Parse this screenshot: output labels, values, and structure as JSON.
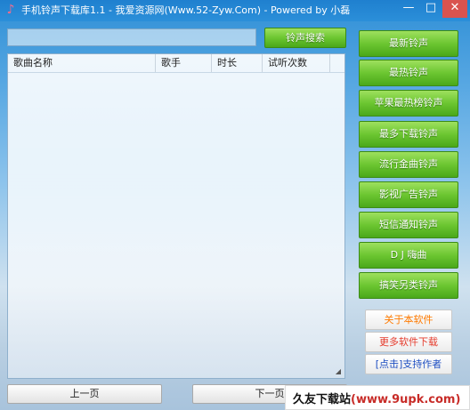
{
  "window": {
    "title": "手机铃声下载库1.1 - 我爱资源网(Www.52-Zyw.Com) - Powered by 小磊",
    "min_glyph": "—",
    "max_glyph": "□",
    "close_glyph": "✕"
  },
  "search": {
    "value": "",
    "button_label": "铃声搜索"
  },
  "list": {
    "columns": [
      "歌曲名称",
      "歌手",
      "时长",
      "试听次数"
    ]
  },
  "categories": [
    "最新铃声",
    "最热铃声",
    "苹果最热榜铃声",
    "最多下载铃声",
    "流行金曲铃声",
    "影视广告铃声",
    "短信通知铃声",
    "D J 嗨曲",
    "搞笑另类铃声"
  ],
  "links": {
    "about": "关于本软件",
    "more_software": "更多软件下载",
    "support": "[点击]支持作者"
  },
  "pager": {
    "prev": "上一页",
    "next": "下一页"
  },
  "watermark": {
    "site": "久友下载站",
    "url": "(www.9upk.com)"
  },
  "icons": {
    "app": "music-note-icon"
  },
  "colors": {
    "green_button": "#6cc631",
    "titlebar": "#1f80cf",
    "close": "#d9534f"
  }
}
